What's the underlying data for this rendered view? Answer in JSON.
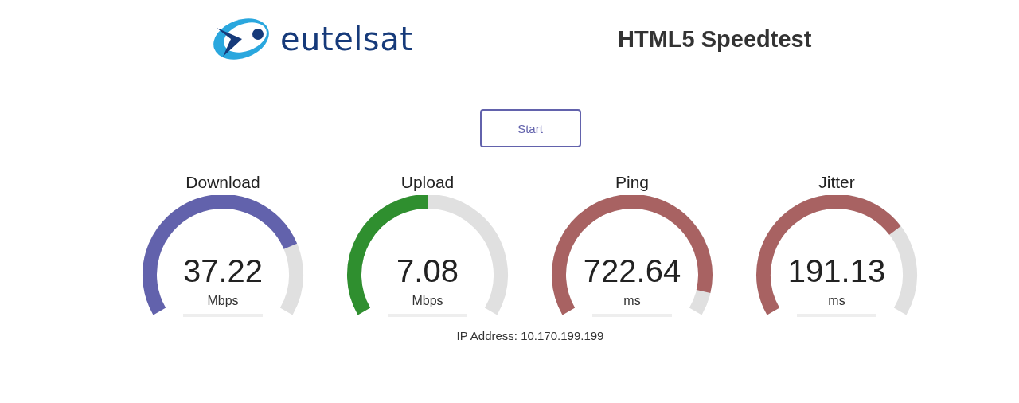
{
  "header": {
    "logo_text": "eutelsat",
    "title": "HTML5 Speedtest"
  },
  "start_button": {
    "label": "Start"
  },
  "gauges": [
    {
      "label": "Download",
      "value": "37.22",
      "unit": "Mbps",
      "color": "#6262ac"
    },
    {
      "label": "Upload",
      "value": "7.08",
      "unit": "Mbps",
      "color": "#2f8f2f"
    },
    {
      "label": "Ping",
      "value": "722.64",
      "unit": "ms",
      "color": "#a86262"
    },
    {
      "label": "Jitter",
      "value": "191.13",
      "unit": "ms",
      "color": "#a86262"
    }
  ],
  "ip_address": "IP Address: 10.170.199.199"
}
